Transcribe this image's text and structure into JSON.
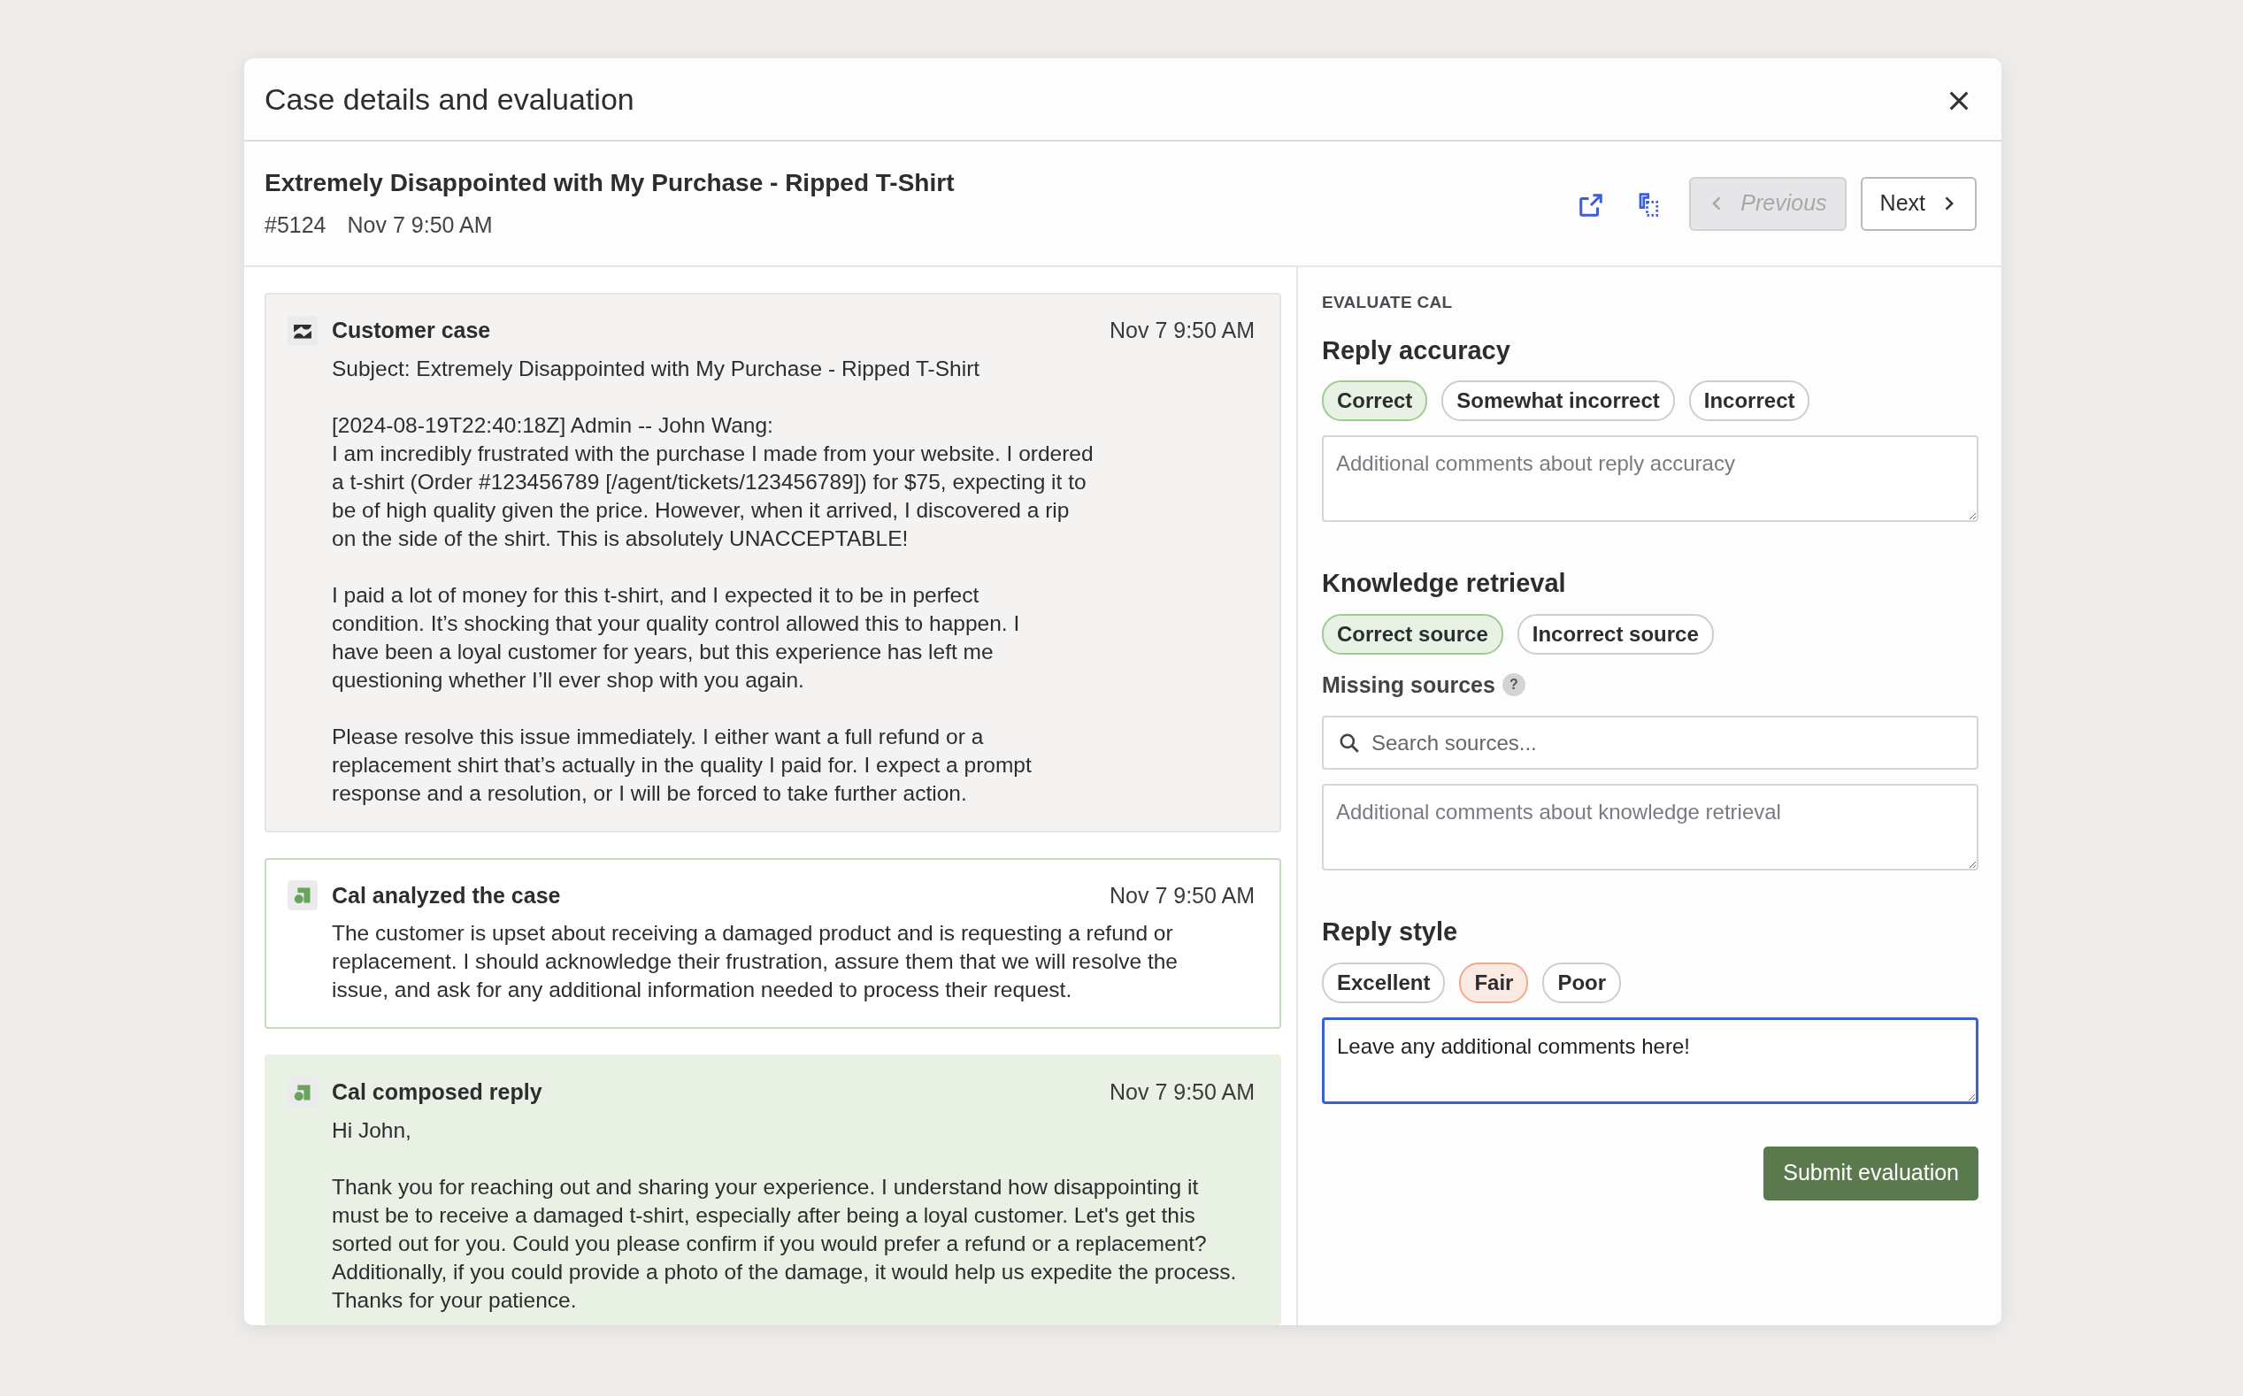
{
  "dialog": {
    "title": "Case details and evaluation"
  },
  "case": {
    "title": "Extremely Disappointed with My Purchase - Ripped T-Shirt",
    "number": "#5124",
    "time": "Nov 7 9:50 AM"
  },
  "navigation": [
    {
      "kind": "previous",
      "label": "Previous",
      "disabled": true
    },
    {
      "kind": "next",
      "label": "Next",
      "disabled": false
    }
  ],
  "timeline": [
    {
      "kind": "customer",
      "title": "Customer case",
      "time": "Nov 7 9:50 AM",
      "paragraphs": [
        "Subject: Extremely Disappointed with My Purchase - Ripped T-Shirt",
        "[2024-08-19T22:40:18Z] Admin -- John Wang:\nI am incredibly frustrated with the purchase I made from your website. I ordered\na t-shirt (Order #123456789 [/agent/tickets/123456789]) for $75, expecting it to\nbe of high quality given the price. However, when it arrived, I discovered a rip\non the side of the shirt. This is absolutely UNACCEPTABLE!",
        "I paid a lot of money for this t-shirt, and I expected it to be in perfect\ncondition. It’s shocking that your quality control allowed this to happen. I\nhave been a loyal customer for years, but this experience has left me\nquestioning whether I’ll ever shop with you again.",
        "Please resolve this issue immediately. I either want a full refund or a\nreplacement shirt that’s actually in the quality I paid for. I expect a prompt\nresponse and a resolution, or I will be forced to take further action."
      ]
    },
    {
      "kind": "analysis",
      "title": "Cal analyzed the case",
      "time": "Nov 7 9:50 AM",
      "paragraphs": [
        "The customer is upset about receiving a damaged product and is requesting a refund or replacement. I should acknowledge their frustration, assure them that we will resolve the issue, and ask for any additional information needed to process their request."
      ]
    },
    {
      "kind": "reply",
      "title": "Cal composed reply",
      "time": "Nov 7 9:50 AM",
      "paragraphs": [
        "Hi John,",
        "Thank you for reaching out and sharing your experience. I understand how disappointing it must be to receive a damaged t-shirt, especially after being a loyal customer. Let's get this sorted out for you. Could you please confirm if you would prefer a refund or a replacement? Additionally, if you could provide a photo of the damage, it would help us expedite the process. Thanks for your patience."
      ]
    }
  ],
  "evaluation": {
    "heading": "EVALUATE CAL",
    "sections": [
      {
        "title": "Reply accuracy",
        "color": "#9fcb92",
        "options": [
          {
            "label": "Correct",
            "selected": true
          },
          {
            "label": "Somewhat incorrect",
            "selected": false
          },
          {
            "label": "Incorrect",
            "selected": false
          }
        ],
        "comment": {
          "placeholder": "Additional comments about reply accuracy",
          "focused": false
        }
      },
      {
        "title": "Knowledge retrieval",
        "color": "#9fcb92",
        "options": [
          {
            "label": "Correct source",
            "selected": true
          },
          {
            "label": "Incorrect source",
            "selected": false
          }
        ],
        "missing_sources": {
          "label": "Missing sources",
          "help": "?",
          "placeholder": "Search sources..."
        },
        "comment": {
          "placeholder": "Additional comments about knowledge retrieval",
          "focused": false
        }
      },
      {
        "title": "Reply style",
        "color": "#f0a98a",
        "options": [
          {
            "label": "Excellent",
            "selected": false
          },
          {
            "label": "Fair",
            "selected": true
          },
          {
            "label": "Poor",
            "selected": false
          }
        ],
        "comment": {
          "value": "Leave any additional comments here!",
          "focused": true
        }
      }
    ],
    "submit": "Submit evaluation"
  }
}
